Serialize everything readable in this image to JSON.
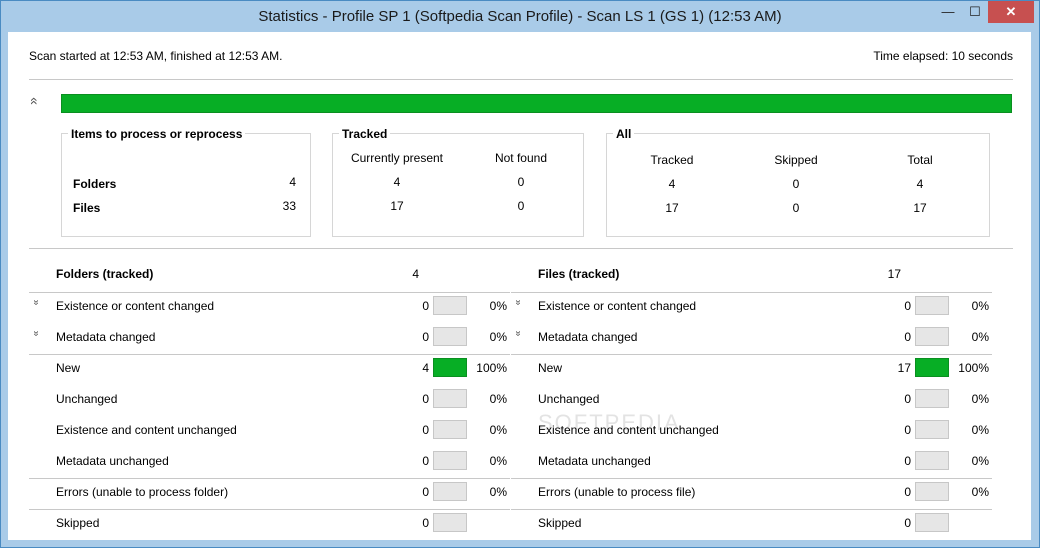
{
  "window": {
    "title": "Statistics - Profile SP 1 (Softpedia Scan Profile) - Scan LS 1 (GS 1) (12:53 AM)",
    "minimize_glyph": "—",
    "maximize_glyph": "☐",
    "close_glyph": "✕"
  },
  "header": {
    "scan_info": "Scan started at 12:53 AM, finished at 12:53 AM.",
    "elapsed": "Time elapsed: 10 seconds"
  },
  "progress": {
    "value": 1.0,
    "color": "#07ae25",
    "collapse_icon": "«"
  },
  "items_group": {
    "title": "Items to process or reprocess",
    "rows": [
      {
        "label": "Folders",
        "value": "4"
      },
      {
        "label": "Files",
        "value": "33"
      }
    ]
  },
  "tracked_group": {
    "title": "Tracked",
    "columns": [
      "Currently present",
      "Not found"
    ],
    "rows": [
      [
        "4",
        "0"
      ],
      [
        "17",
        "0"
      ]
    ]
  },
  "all_group": {
    "title": "All",
    "columns": [
      "Tracked",
      "Skipped",
      "Total"
    ],
    "rows": [
      [
        "4",
        "0",
        "4"
      ],
      [
        "17",
        "0",
        "17"
      ]
    ]
  },
  "folders": {
    "header": "Folders (tracked)",
    "total": "4",
    "rows": [
      {
        "label": "Existence or content changed",
        "count": "0",
        "pct": "0%",
        "fill": 0.0,
        "expandable": true
      },
      {
        "label": "Metadata changed",
        "count": "0",
        "pct": "0%",
        "fill": 0.0,
        "expandable": true
      },
      {
        "label": "New",
        "count": "4",
        "pct": "100%",
        "fill": 1.0,
        "expandable": false
      },
      {
        "label": "Unchanged",
        "count": "0",
        "pct": "0%",
        "fill": 0.0,
        "expandable": false
      },
      {
        "label": "Existence and content unchanged",
        "count": "0",
        "pct": "0%",
        "fill": 0.0,
        "expandable": false
      },
      {
        "label": "Metadata unchanged",
        "count": "0",
        "pct": "0%",
        "fill": 0.0,
        "expandable": false
      },
      {
        "label": "Errors (unable to process folder)",
        "count": "0",
        "pct": "0%",
        "fill": 0.0,
        "expandable": false
      },
      {
        "label": "Skipped",
        "count": "0",
        "pct": "",
        "fill": 0.0,
        "expandable": false
      }
    ]
  },
  "files": {
    "header": "Files (tracked)",
    "total": "17",
    "rows": [
      {
        "label": "Existence or content changed",
        "count": "0",
        "pct": "0%",
        "fill": 0.0,
        "expandable": true
      },
      {
        "label": "Metadata changed",
        "count": "0",
        "pct": "0%",
        "fill": 0.0,
        "expandable": true
      },
      {
        "label": "New",
        "count": "17",
        "pct": "100%",
        "fill": 1.0,
        "expandable": false
      },
      {
        "label": "Unchanged",
        "count": "0",
        "pct": "0%",
        "fill": 0.0,
        "expandable": false
      },
      {
        "label": "Existence and content unchanged",
        "count": "0",
        "pct": "0%",
        "fill": 0.0,
        "expandable": false
      },
      {
        "label": "Metadata unchanged",
        "count": "0",
        "pct": "0%",
        "fill": 0.0,
        "expandable": false
      },
      {
        "label": "Errors (unable to process file)",
        "count": "0",
        "pct": "0%",
        "fill": 0.0,
        "expandable": false
      },
      {
        "label": "Skipped",
        "count": "0",
        "pct": "",
        "fill": 0.0,
        "expandable": false
      }
    ]
  },
  "expand_icon": "»",
  "watermark": "SOFTPEDIA"
}
